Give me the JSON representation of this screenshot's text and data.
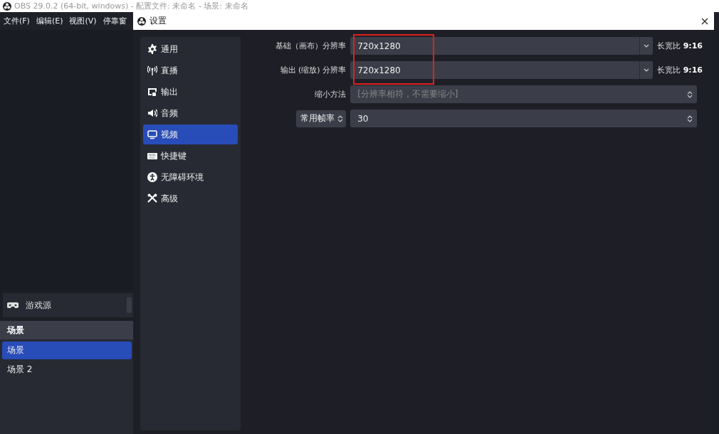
{
  "main_window": {
    "title": "OBS 29.0.2 (64-bit, windows) - 配置文件: 未命名 - 场景: 未命名",
    "menu": [
      "文件(F)",
      "编辑(E)",
      "视图(V)",
      "停靠窗"
    ],
    "sources": [
      {
        "name": "游戏源"
      }
    ],
    "scenes": {
      "title": "场景",
      "items": [
        {
          "name": "场景",
          "selected": true
        },
        {
          "name": "场景 2",
          "selected": false
        }
      ]
    }
  },
  "settings_dialog": {
    "title": "设置",
    "sidebar": [
      {
        "label": "通用",
        "selected": false
      },
      {
        "label": "直播",
        "selected": false
      },
      {
        "label": "输出",
        "selected": false
      },
      {
        "label": "音频",
        "selected": false
      },
      {
        "label": "视频",
        "selected": true
      },
      {
        "label": "快捷键",
        "selected": false
      },
      {
        "label": "无障碍环境",
        "selected": false
      },
      {
        "label": "高级",
        "selected": false
      }
    ],
    "rows": [
      {
        "kind": "combo",
        "label": "基础（画布）分辨率",
        "value": "720x1280",
        "aspect_label": "长宽比",
        "aspect": "9:16"
      },
      {
        "kind": "combo",
        "label": "输出 (缩放) 分辨率",
        "value": "720x1280",
        "aspect_label": "长宽比",
        "aspect": "9:16"
      },
      {
        "kind": "spin",
        "label": "缩小方法",
        "value": "[分辨率相符，不需要缩小]",
        "disabled": true
      },
      {
        "kind": "fps",
        "label": "常用帧率",
        "value": "30",
        "disabled": false
      }
    ]
  }
}
